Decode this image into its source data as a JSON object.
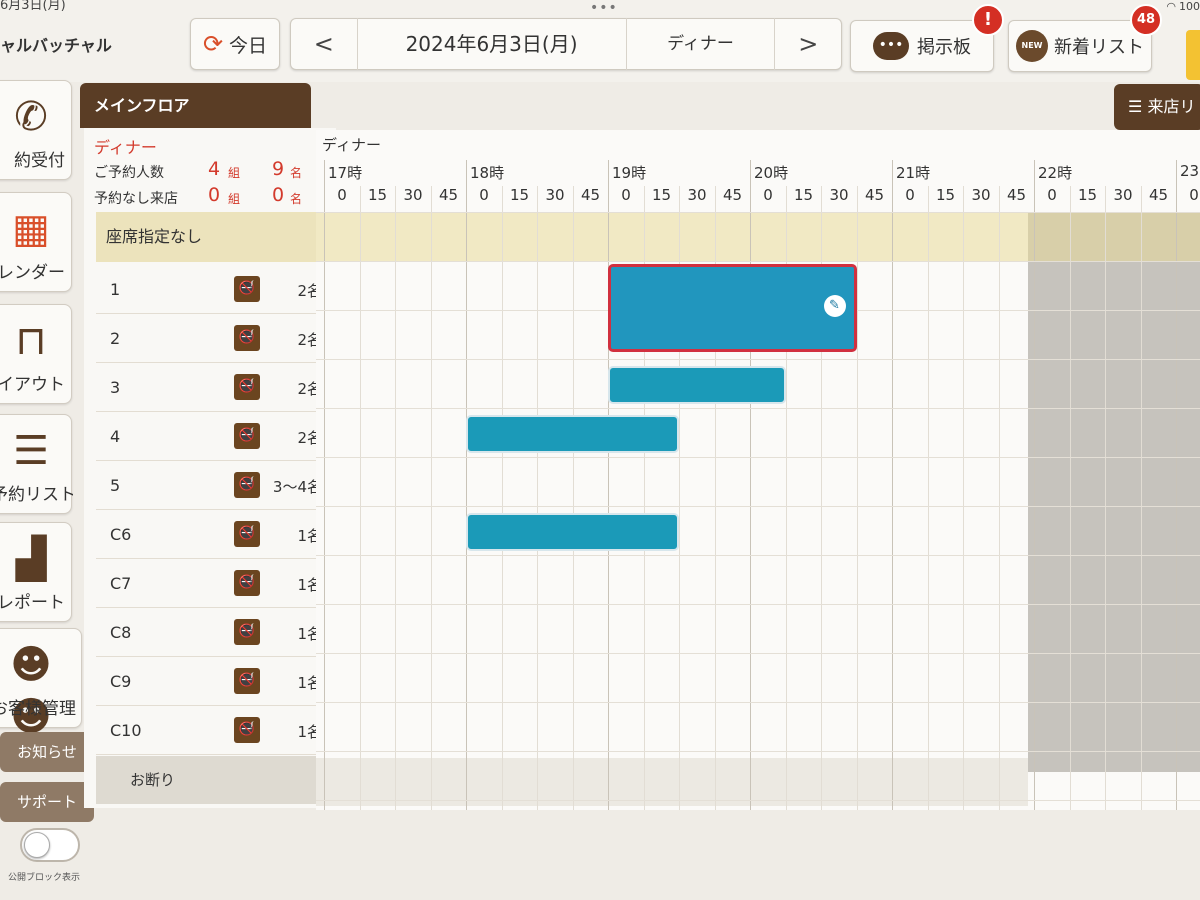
{
  "status": {
    "time_partial": "6月3日(月)",
    "battery": "100"
  },
  "header": {
    "store_name": "ャルバッチャル",
    "today_label": "今日",
    "prev_icon": "chevron-left",
    "next_icon": "chevron-right",
    "date_label": "2024年6月3日(月)",
    "meal_label": "ディナー",
    "board_label": "掲示板",
    "board_badge": "!",
    "newlist_label": "新着リスト",
    "newlist_badge": "48",
    "new_icon_text": "NEW"
  },
  "nav": {
    "items": [
      {
        "label": "約受付",
        "icon": "phone-icon"
      },
      {
        "label": "レンダー",
        "icon": "calendar-icon"
      },
      {
        "label": "イアウト",
        "icon": "table-icon"
      },
      {
        "label": "予約リスト",
        "icon": "list-icon"
      },
      {
        "label": "レポート",
        "icon": "bar-chart-icon"
      },
      {
        "label": "お客様管理",
        "icon": "customers-icon"
      }
    ],
    "notice_label": "お知らせ",
    "support_label": "サポート",
    "toggle_label": "公開ブロック表示"
  },
  "floor_tab": "メインフロア",
  "visit_list_label": "来店リ",
  "summary": {
    "meal": "ディナー",
    "reserved_label": "ご予約人数",
    "reserved_groups": "4",
    "reserved_people": "9",
    "walkin_label": "予約なし来店",
    "walkin_groups": "0",
    "walkin_people": "0",
    "group_unit": "組",
    "people_unit": "名"
  },
  "no_seat_label": "座席指定なし",
  "decline_label": "お断り",
  "tables": [
    {
      "name": "1",
      "cap": "2名"
    },
    {
      "name": "2",
      "cap": "2名"
    },
    {
      "name": "3",
      "cap": "2名"
    },
    {
      "name": "4",
      "cap": "2名"
    },
    {
      "name": "5",
      "cap": "3〜4名"
    },
    {
      "name": "C6",
      "cap": "1名"
    },
    {
      "name": "C7",
      "cap": "1名"
    },
    {
      "name": "C8",
      "cap": "1名"
    },
    {
      "name": "C9",
      "cap": "1名"
    },
    {
      "name": "C10",
      "cap": "1名"
    }
  ],
  "timeline": {
    "meal_label": "ディナー",
    "hours": [
      "17時",
      "18時",
      "19時",
      "20時",
      "21時",
      "22時",
      "23"
    ],
    "minutes": [
      "0",
      "15",
      "30",
      "45"
    ]
  },
  "reservations": [
    {
      "table": "1",
      "start": "19:00",
      "end": "20:45",
      "selected": true
    },
    {
      "table": "3",
      "start": "19:00",
      "end": "20:15",
      "selected": false
    },
    {
      "table": "4",
      "start": "18:00",
      "end": "19:30",
      "selected": false
    },
    {
      "table": "C6",
      "start": "18:00",
      "end": "19:30",
      "selected": false
    }
  ],
  "colors": {
    "brand_brown": "#5a3d25",
    "alert_red": "#d42f24",
    "reservation_blue": "#1b9ab8",
    "no_seat_yellow": "#f1e9c4"
  }
}
